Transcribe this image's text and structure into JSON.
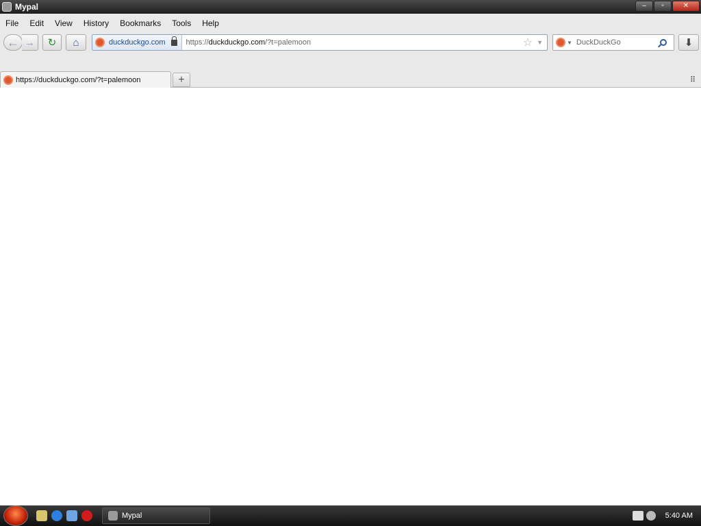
{
  "window": {
    "title": "Mypal",
    "controls": {
      "minimize": "–",
      "restore": "▫",
      "close": "✕"
    }
  },
  "menubar": [
    "File",
    "Edit",
    "View",
    "History",
    "Bookmarks",
    "Tools",
    "Help"
  ],
  "navbar": {
    "back_icon": "back-arrow-icon",
    "forward_icon": "forward-arrow-icon",
    "reload_icon": "reload-icon",
    "home_icon": "home-icon",
    "identity_label": "duckduckgo.com",
    "url_prefix": "https://",
    "url_host": "duckduckgo.com",
    "url_rest": "/?t=palemoon",
    "search_placeholder": "DuckDuckGo",
    "download_icon": "download-icon"
  },
  "tabs": [
    {
      "label": "https://duckduckgo.com/?t=palemoon"
    }
  ],
  "taskbar": {
    "task_label": "Mypal",
    "clock": "5:40 AM"
  }
}
